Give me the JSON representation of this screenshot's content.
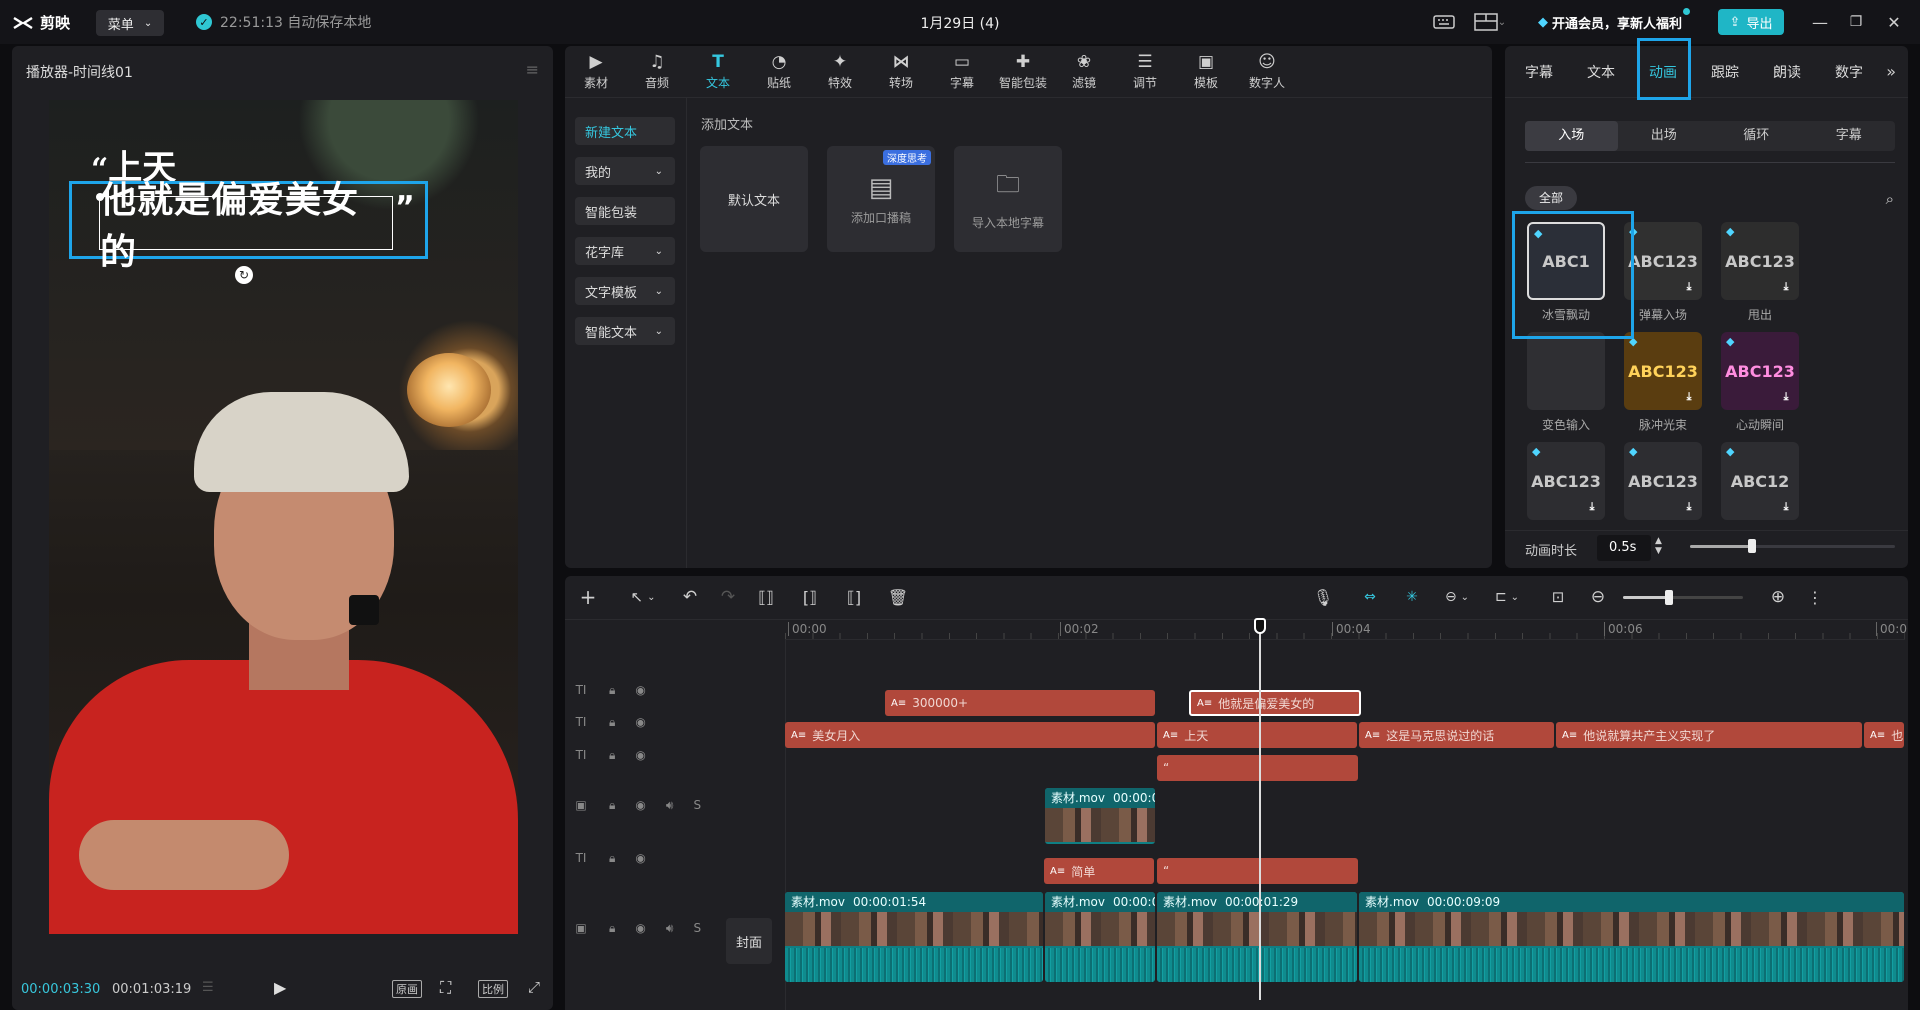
{
  "app": {
    "logo_text": "剪映",
    "menu_label": "菜单",
    "autosave_text": "22:51:13 自动保存本地",
    "project_title": "1月29日 (4)",
    "vip_text": "开通会员，享新人福利",
    "export_label": "导出"
  },
  "player": {
    "title": "播放器-时间线01",
    "current_time": "00:00:03:30",
    "total_time": "00:01:03:19",
    "original_label": "原画",
    "ratio_label": "比例",
    "caption_top": "上天",
    "caption_main": "他就是偏爱美女的",
    "quote_open": "“",
    "quote_close": "”"
  },
  "toolbar": {
    "items": [
      {
        "label": "素材",
        "icon": "media-icon"
      },
      {
        "label": "音频",
        "icon": "audio-icon"
      },
      {
        "label": "文本",
        "icon": "text-icon",
        "active": true
      },
      {
        "label": "贴纸",
        "icon": "sticker-icon"
      },
      {
        "label": "特效",
        "icon": "effects-icon"
      },
      {
        "label": "转场",
        "icon": "transition-icon"
      },
      {
        "label": "字幕",
        "icon": "subtitle-icon"
      },
      {
        "label": "智能包装",
        "icon": "smart-pack-icon"
      },
      {
        "label": "滤镜",
        "icon": "filter-icon"
      },
      {
        "label": "调节",
        "icon": "adjust-icon"
      },
      {
        "label": "模板",
        "icon": "template-icon"
      },
      {
        "label": "数字人",
        "icon": "digital-human-icon"
      }
    ]
  },
  "text_panel": {
    "sidebar": [
      {
        "label": "新建文本",
        "active": true
      },
      {
        "label": "我的",
        "dropdown": true
      },
      {
        "label": "智能包装"
      },
      {
        "label": "花字库",
        "dropdown": true
      },
      {
        "label": "文字模板",
        "dropdown": true
      },
      {
        "label": "智能文本",
        "dropdown": true
      }
    ],
    "section_title": "添加文本",
    "cards": [
      {
        "label": "默认文本"
      },
      {
        "label": "添加口播稿",
        "badge": "深度思考"
      },
      {
        "label": "导入本地字幕"
      }
    ]
  },
  "right_panel": {
    "tabs": [
      "字幕",
      "文本",
      "动画",
      "跟踪",
      "朗读",
      "数字"
    ],
    "active_tab": "动画",
    "subtabs": [
      "入场",
      "出场",
      "循环",
      "字幕"
    ],
    "active_subtab": "入场",
    "filter": "全部",
    "presets": [
      {
        "label": "冰雪飘动",
        "preview": "ABC1"
      },
      {
        "label": "弹幕入场",
        "preview": "ABC123"
      },
      {
        "label": "甩出",
        "preview": "ABC123"
      },
      {
        "label": "变色输入",
        "preview": ""
      },
      {
        "label": "脉冲光束",
        "preview": "ABC123"
      },
      {
        "label": "心动瞬间",
        "preview": "ABC123"
      },
      {
        "label": "",
        "preview": "ABC123"
      },
      {
        "label": "",
        "preview": "ABC123"
      },
      {
        "label": "",
        "preview": "ABC12"
      }
    ],
    "duration_label": "动画时长",
    "duration_value": "0.5s",
    "duration_level": 0.3
  },
  "timeline": {
    "ruler": [
      "00:00",
      "00:02",
      "00:04",
      "00:06",
      "00:0"
    ],
    "cover_label": "封面",
    "zoom_level": 0.38,
    "text_clips": [
      {
        "text": "300000+"
      },
      {
        "text": "他就是偏爱美女的"
      },
      {
        "text": "美女月入"
      },
      {
        "text": "上天"
      },
      {
        "text": "这是马克思说过的话"
      },
      {
        "text": "他说就算共产主义实现了"
      },
      {
        "text": "也"
      },
      {
        "text": "“"
      },
      {
        "text": "简单"
      },
      {
        "text": "“"
      }
    ],
    "video_clips": [
      {
        "name": "素材.mov",
        "duration": "00:00:0"
      },
      {
        "name": "素材.mov",
        "duration": "00:00:01:54"
      },
      {
        "name": "素材.mov",
        "duration": "00:00:0"
      },
      {
        "name": "素材.mov",
        "duration": "00:00:01:29"
      },
      {
        "name": "素材.mov",
        "duration": "00:00:09:09"
      }
    ]
  }
}
